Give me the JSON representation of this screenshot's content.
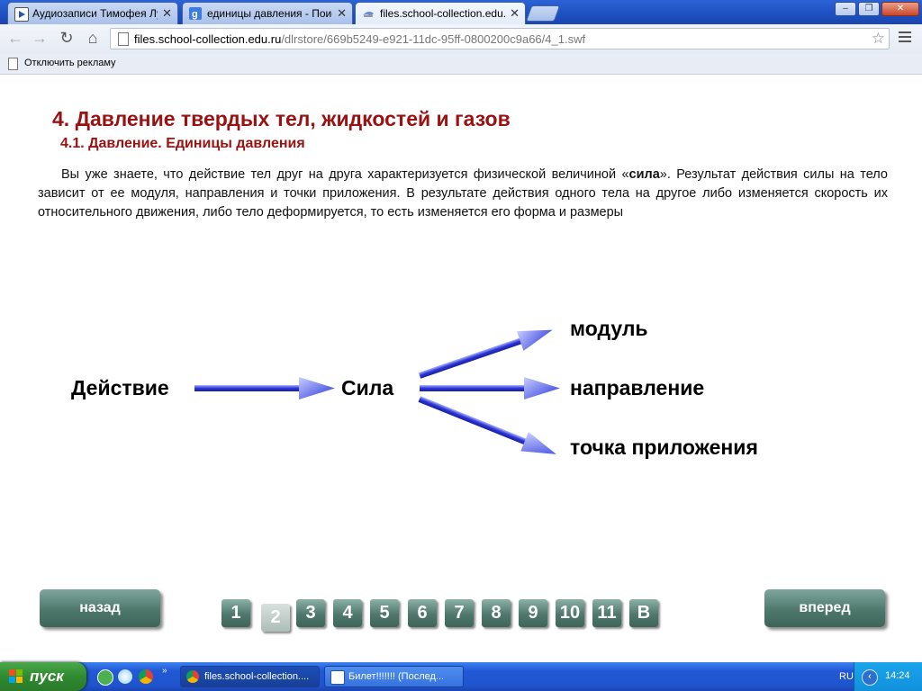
{
  "browser": {
    "tabs": [
      {
        "title": "Аудиозаписи Тимофея Лунев",
        "icon": "play-icon"
      },
      {
        "title": "единицы давления - Поиск в",
        "icon": "google-icon"
      },
      {
        "title": "files.school-collection.edu.ru",
        "icon": "page-icon"
      }
    ],
    "window_controls": {
      "minimize": "–",
      "maximize": "❐",
      "close": "✕"
    },
    "nav": {
      "back": "←",
      "forward": "→",
      "reload": "↻",
      "home": "⌂"
    },
    "address": {
      "host": "files.school-collection.edu.ru",
      "path": "/dlrstore/669b5249-e921-11dc-95ff-0800200c9a66/4_1.swf"
    },
    "bookmarks": [
      {
        "label": "Отключить рекламу"
      }
    ]
  },
  "page": {
    "title": "4. Давление твердых тел, жидкостей и газов",
    "subtitle": "4.1. Давление. Единицы давления",
    "paragraph": {
      "part1": "Вы уже знаете, что действие тел друг на друга характеризуется физической величиной «",
      "strong": "сила",
      "part2": "». Результат действия силы на тело зависит от ее модуля, направления и точки приложения. В результате действия одного тела на другое либо изменяется скорость их относительного движения, либо тело деформируется, то есть изменяется его форма и размеры"
    },
    "diagram": {
      "source": "Действие",
      "middle": "Сила",
      "targets": [
        "модуль",
        "направление",
        "точка приложения"
      ]
    },
    "nav": {
      "back": "назад",
      "forward": "вперед",
      "pages": [
        "1",
        "2",
        "3",
        "4",
        "5",
        "6",
        "7",
        "8",
        "9",
        "10",
        "11",
        "В"
      ],
      "current_page": "2"
    }
  },
  "taskbar": {
    "start": "пуск",
    "tasks": [
      {
        "title": "files.school-collection....",
        "icon": "chrome-icon"
      },
      {
        "title": "Билет!!!!!!! (Послед...",
        "icon": "word-icon"
      }
    ],
    "language": "RU",
    "time": "14:24"
  },
  "colors": {
    "heading": "#9b1111",
    "arrow": "#2a35d8",
    "button": "#4e786d",
    "taskbar": "#2254d0"
  }
}
